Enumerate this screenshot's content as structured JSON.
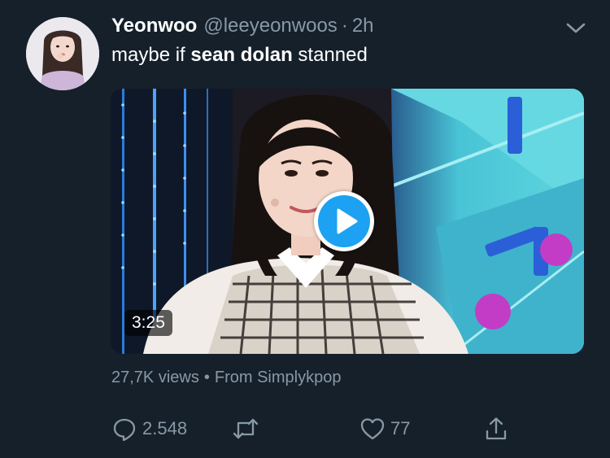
{
  "tweet": {
    "display_name": "Yeonwoo",
    "handle": "@leeyeonwoos",
    "separator": "·",
    "time": "2h",
    "text_prefix": "maybe if ",
    "text_bold": "sean dolan",
    "text_suffix": " stanned",
    "more_icon": "chevron-down-icon",
    "avatar_icon": "avatar"
  },
  "media": {
    "type": "video",
    "duration": "3:25",
    "play_icon": "play-icon"
  },
  "meta": {
    "views": "27,7K views",
    "separator": "•",
    "source": "From Simplykpop"
  },
  "actions": {
    "reply_count": "2.548",
    "retweet_count": "",
    "like_count": "77",
    "reply_icon": "reply-icon",
    "retweet_icon": "retweet-icon",
    "like_icon": "heart-icon",
    "share_icon": "share-icon"
  },
  "colors": {
    "background": "#15202b",
    "primary_text": "#ffffff",
    "secondary_text": "#8899a6",
    "accent": "#1da1f2"
  }
}
